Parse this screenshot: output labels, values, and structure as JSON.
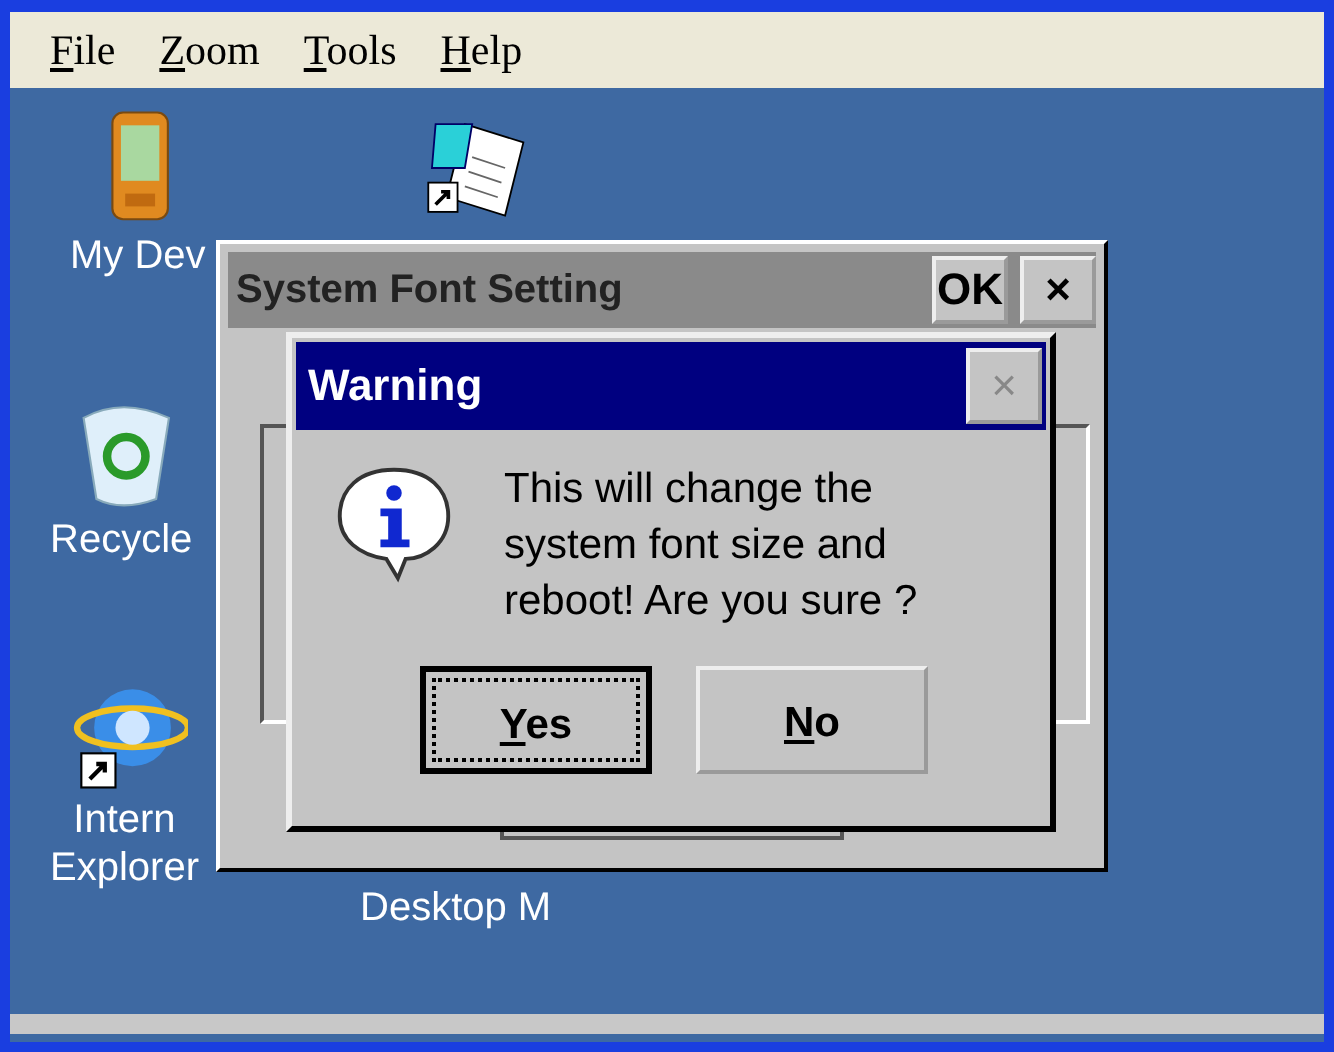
{
  "menu": [
    {
      "label": "File"
    },
    {
      "label": "Zoom"
    },
    {
      "label": "Tools"
    },
    {
      "label": "Help"
    }
  ],
  "desktop_icons": [
    {
      "kind": "device",
      "lines": [
        "My Dev"
      ]
    },
    {
      "kind": "document"
    },
    {
      "kind": "recycle",
      "lines": [
        "Recycle"
      ]
    },
    {
      "kind": "browser",
      "lines": [
        "Intern",
        "Explorer"
      ]
    },
    {
      "kind": "blank",
      "lines": [
        "Desktop M"
      ]
    }
  ],
  "back_window": {
    "title": "System Font Setting",
    "ok_button": "OK",
    "close_button": "×"
  },
  "dialog": {
    "title": "Warning",
    "close_button": "×",
    "message_lines": [
      "This will change the",
      "system font size and",
      "reboot! Are you sure ?"
    ],
    "buttons": [
      {
        "label": "Yes",
        "focused": true
      },
      {
        "label": "No",
        "focused": false
      }
    ]
  }
}
